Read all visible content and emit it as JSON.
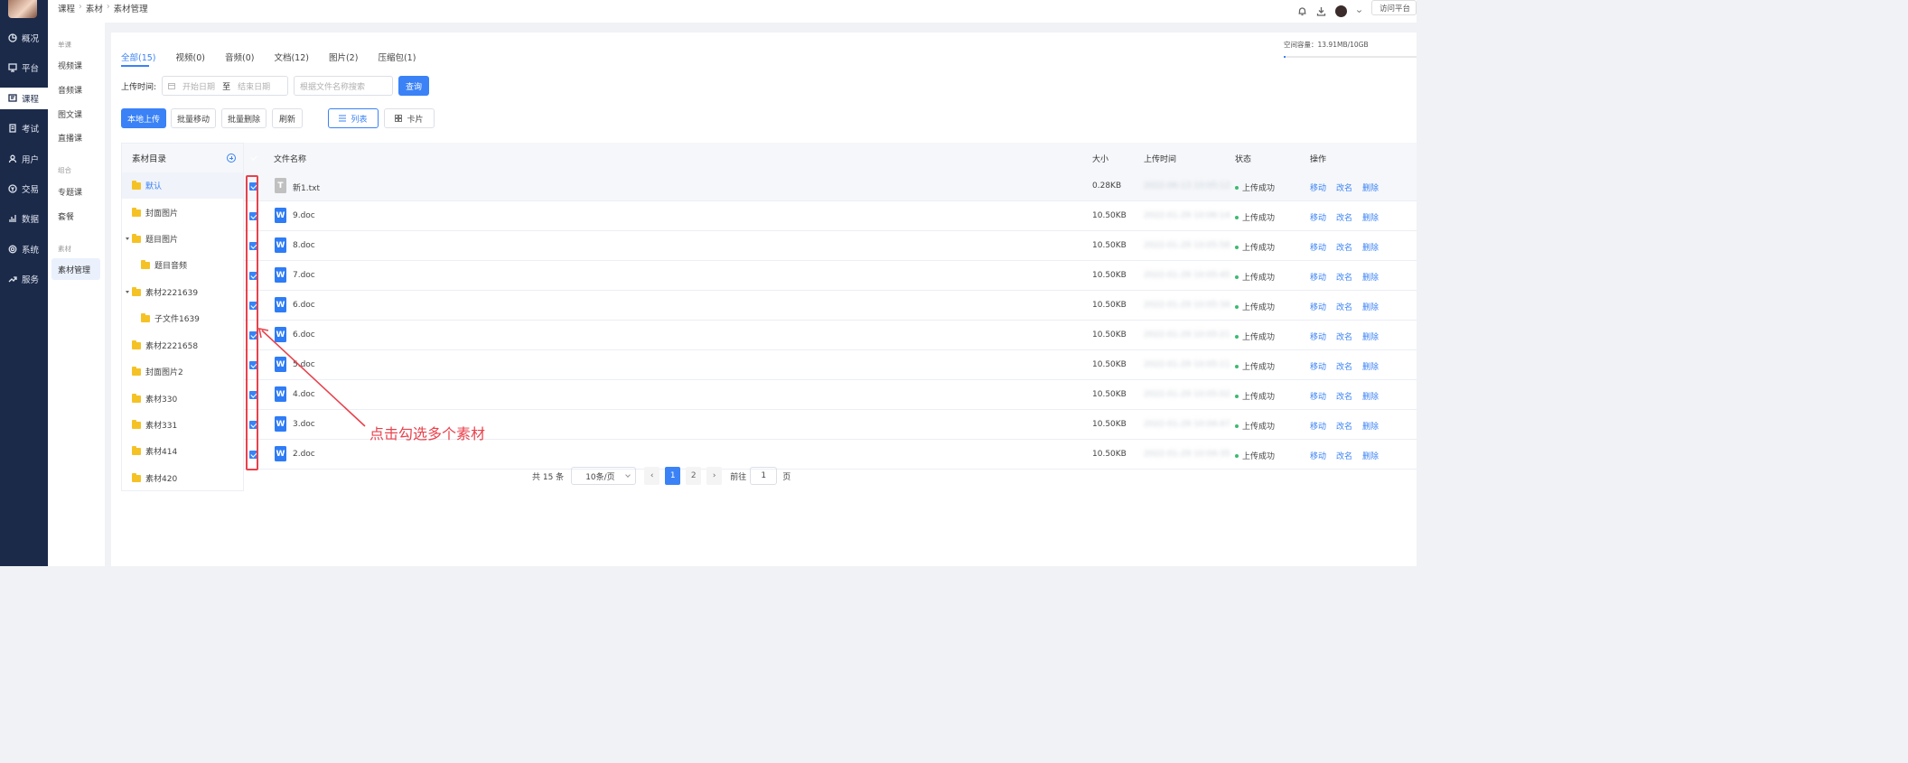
{
  "breadcrumb": [
    "课程",
    "素材",
    "素材管理"
  ],
  "top_right": {
    "visit_label": "访问平台"
  },
  "nav": [
    {
      "label": "概况",
      "icon": "dashboard-icon"
    },
    {
      "label": "平台",
      "icon": "monitor-icon"
    },
    {
      "label": "课程",
      "icon": "book-icon",
      "active": true
    },
    {
      "label": "考试",
      "icon": "exam-icon"
    },
    {
      "label": "用户",
      "icon": "user-icon"
    },
    {
      "label": "交易",
      "icon": "trade-icon"
    },
    {
      "label": "数据",
      "icon": "bar-chart-icon"
    },
    {
      "label": "系统",
      "icon": "gear-icon"
    },
    {
      "label": "服务",
      "icon": "service-icon"
    }
  ],
  "submenu": {
    "group1": "单课",
    "group1_items": [
      "视频课",
      "音频课",
      "图文课",
      "直播课"
    ],
    "group2": "组合",
    "group2_items": [
      "专题课",
      "套餐"
    ],
    "group3": "素材",
    "group3_items": [
      "素材管理"
    ]
  },
  "tabs": [
    "全部(15)",
    "视频(0)",
    "音频(0)",
    "文档(12)",
    "图片(2)",
    "压缩包(1)"
  ],
  "storage": {
    "label": "空间容量：13.91MB/10GB",
    "used_fraction": 0.0014
  },
  "filter": {
    "label": "上传时间:",
    "start_placeholder": "开始日期",
    "to": "至",
    "end_placeholder": "结束日期",
    "search_placeholder": "根据文件名称搜索",
    "query": "查询"
  },
  "actions": {
    "upload": "本地上传",
    "batch_move": "批量移动",
    "batch_delete": "批量删除",
    "refresh": "刷新",
    "list": "列表",
    "card": "卡片"
  },
  "tree": {
    "title": "素材目录",
    "nodes": [
      "默认",
      "封面图片",
      "题目图片",
      "题目音频",
      "素材2221639",
      "子文件1639",
      "素材2221658",
      "封面图片2",
      "素材330",
      "素材331",
      "素材414",
      "素材420"
    ]
  },
  "table": {
    "headers": [
      "文件名称",
      "大小",
      "上传时间",
      "状态",
      "操作"
    ],
    "ops": [
      "移动",
      "改名",
      "删除"
    ],
    "rows": [
      {
        "name": "新1.txt",
        "icon_letter": "T",
        "size": "0.28KB",
        "time": "2022-06-13 10:05:12",
        "status": "上传成功"
      },
      {
        "name": "9.doc",
        "icon_letter": "W",
        "size": "10.50KB",
        "time": "2022-01-29 10:06:14",
        "status": "上传成功"
      },
      {
        "name": "8.doc",
        "icon_letter": "W",
        "size": "10.50KB",
        "time": "2022-01-29 10:05:58",
        "status": "上传成功"
      },
      {
        "name": "7.doc",
        "icon_letter": "W",
        "size": "10.50KB",
        "time": "2022-01-29 10:05:45",
        "status": "上传成功"
      },
      {
        "name": "6.doc",
        "icon_letter": "W",
        "size": "10.50KB",
        "time": "2022-01-29 10:05:34",
        "status": "上传成功"
      },
      {
        "name": "6.doc",
        "icon_letter": "W",
        "size": "10.50KB",
        "time": "2022-01-29 10:05:21",
        "status": "上传成功"
      },
      {
        "name": "5.doc",
        "icon_letter": "W",
        "size": "10.50KB",
        "time": "2022-01-29 10:05:11",
        "status": "上传成功"
      },
      {
        "name": "4.doc",
        "icon_letter": "W",
        "size": "10.50KB",
        "time": "2022-01-29 10:05:02",
        "status": "上传成功"
      },
      {
        "name": "3.doc",
        "icon_letter": "W",
        "size": "10.50KB",
        "time": "2022-01-29 10:04:47",
        "status": "上传成功"
      },
      {
        "name": "2.doc",
        "icon_letter": "W",
        "size": "10.50KB",
        "time": "2022-01-29 10:04:35",
        "status": "上传成功"
      }
    ]
  },
  "annotation": "点击勾选多个素材",
  "pagination": {
    "total": "共 15 条",
    "page_size": "10条/页",
    "pages": [
      "1",
      "2"
    ],
    "goto": "前往",
    "current": "1",
    "unit": "页"
  },
  "colors": {
    "accent": "#3a82f6",
    "sidebar": "#1c2a4a",
    "annotation": "#e8424c",
    "success": "#3cba73"
  }
}
